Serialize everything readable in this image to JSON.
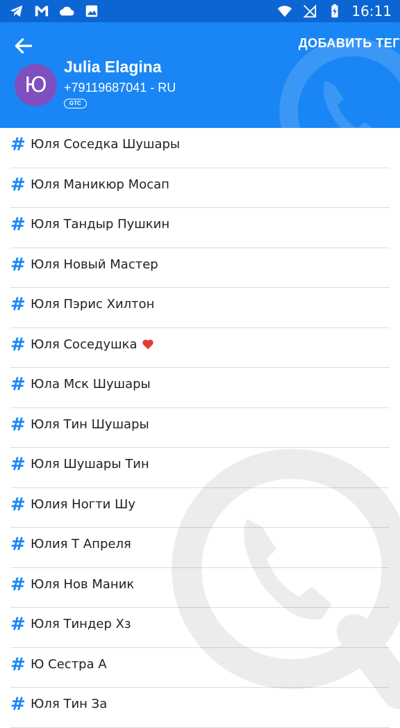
{
  "status_bar": {
    "time": "16:11",
    "left_icons": [
      "telegram-icon",
      "gmail-icon",
      "cloud-icon",
      "image-icon"
    ],
    "right_icons": [
      "wifi-icon",
      "no-signal-icon",
      "battery-charging-icon"
    ]
  },
  "header": {
    "back_icon": "arrow-left-icon",
    "add_tag_label": "ДОБАВИТЬ ТЕГ",
    "avatar_letter": "Ю",
    "name": "Julia Elagina",
    "phone": "+79119687041 - RU",
    "carrier": "GTC",
    "colors": {
      "background": "#1a86f5",
      "status_bar": "#0b65d3",
      "avatar": "#7f4fbf"
    }
  },
  "tags": [
    {
      "label": "Юля Соседка Шушары"
    },
    {
      "label": "Юля Маникюр Мосап"
    },
    {
      "label": "Юля Тандыр Пушкин"
    },
    {
      "label": "Юля Новый Мастер"
    },
    {
      "label": "Юля Пэрис Хилтон"
    },
    {
      "label": "Юля Соседушка",
      "emoji": "heart-icon"
    },
    {
      "label": "Юла Мск Шушары"
    },
    {
      "label": "Юля Тин Шушары"
    },
    {
      "label": "Юля Шушары Тин"
    },
    {
      "label": "Юлия Ногти Шу"
    },
    {
      "label": "Юлия Т Апреля"
    },
    {
      "label": "Юля Нов Маник"
    },
    {
      "label": "Юля Тиндер Хз"
    },
    {
      "label": "Ю Сестра А"
    },
    {
      "label": "Юля Тин За"
    }
  ],
  "tag_icon": "hashtag-icon",
  "accent_color": "#1a86f5"
}
